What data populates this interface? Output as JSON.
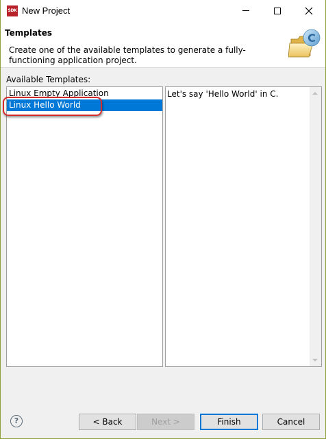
{
  "window": {
    "app_icon_text": "SDK",
    "title": "New Project",
    "controls": {
      "minimize": "minimize-icon",
      "maximize": "maximize-icon",
      "close": "close-icon"
    }
  },
  "banner": {
    "title": "Templates",
    "description": "Create one of the available templates to generate a fully-functioning application project.",
    "icon": "c-project-folder-icon"
  },
  "templates": {
    "label": "Available Templates:",
    "items": [
      {
        "label": "Linux Empty Application",
        "selected": false
      },
      {
        "label": "Linux Hello World",
        "selected": true
      }
    ]
  },
  "description_panel": {
    "text": "Let's say 'Hello World' in C."
  },
  "footer": {
    "help": "?",
    "back": "< Back",
    "next": "Next >",
    "finish": "Finish",
    "cancel": "Cancel"
  },
  "colors": {
    "selection": "#0078d7",
    "highlight_ring": "#d42a2a",
    "window_border": "#8c9f3a"
  }
}
